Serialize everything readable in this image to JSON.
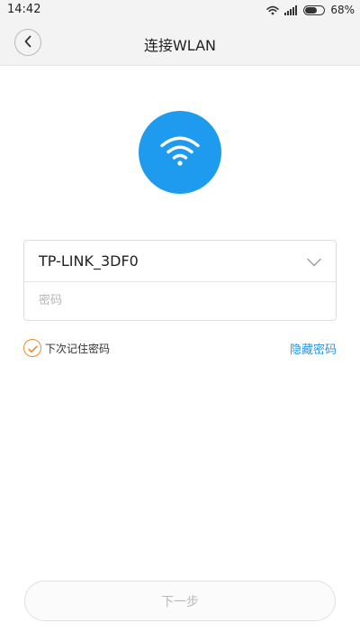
{
  "status_bar": {
    "time": "14:42",
    "battery": "68%",
    "battery_level": 0.68
  },
  "header": {
    "title": "连接WLAN"
  },
  "form": {
    "network_name": "TP-LINK_3DF0",
    "password_placeholder": "密码",
    "password_value": ""
  },
  "options": {
    "remember_label": "下次记住密码",
    "remember_checked": true,
    "hide_password_label": "隐藏密码"
  },
  "actions": {
    "next_label": "下一步"
  },
  "colors": {
    "accent_blue": "#1e9bef",
    "link_blue": "#2b94e6",
    "check_orange": "#f08a24"
  },
  "icons": {
    "back": "chevron-left-icon",
    "hero": "wifi-icon",
    "dropdown": "chevron-down-icon",
    "check": "checkmark-icon"
  }
}
